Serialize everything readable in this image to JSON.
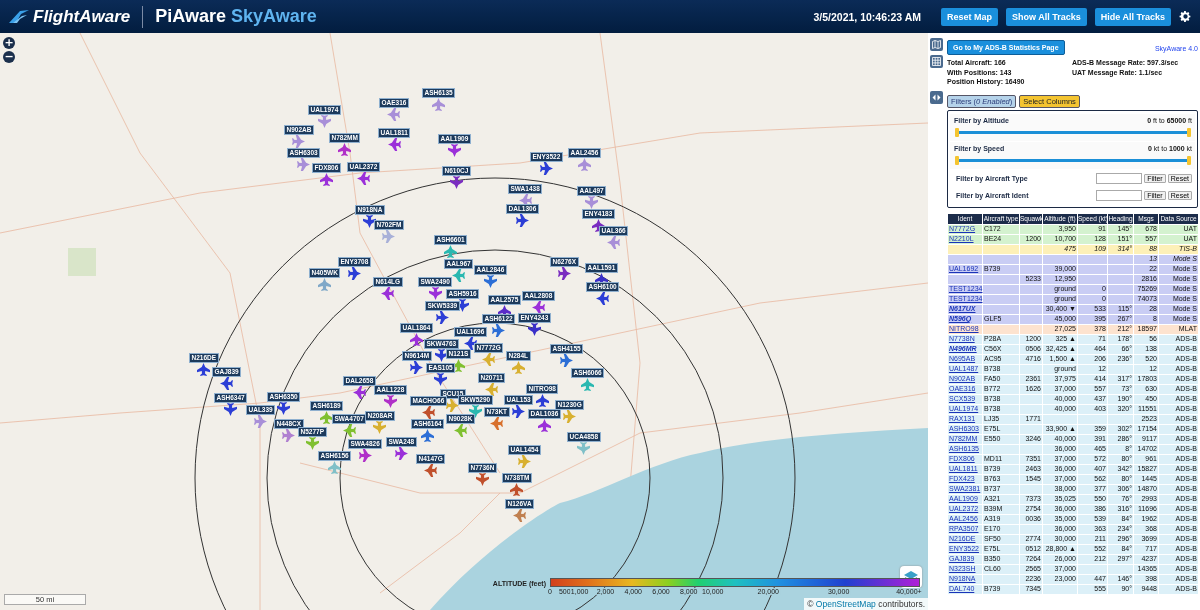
{
  "header": {
    "logo": "FlightAware",
    "title_1": "PiAware",
    "title_2": "SkyAware",
    "datetime": "3/5/2021, 10:46:23 AM",
    "buttons": [
      "Reset Map",
      "Show All Tracks",
      "Hide All Tracks"
    ]
  },
  "map": {
    "zoom_in": "+",
    "zoom_out": "−",
    "aircraft": [
      {
        "label": "ASH6135",
        "color": "#a88fd8"
      },
      {
        "label": "OAE316",
        "color": "#a88fd8"
      },
      {
        "label": "UAL1974",
        "color": "#a88fd8"
      },
      {
        "label": "N902AB",
        "color": "#a88fd8"
      },
      {
        "label": "N782MM",
        "color": "#b030c8"
      },
      {
        "label": "UAL1811",
        "color": "#9b30d9"
      },
      {
        "label": "AAL1909",
        "color": "#9b30d9"
      },
      {
        "label": "ASH6303",
        "color": "#a88fd8"
      },
      {
        "label": "FDX806",
        "color": "#9b30d9"
      },
      {
        "label": "UAL2372",
        "color": "#9b30d9"
      },
      {
        "label": "N610CJ",
        "color": "#7a2cc0"
      },
      {
        "label": "ENY3522",
        "color": "#2c3ed6"
      },
      {
        "label": "AAL2456",
        "color": "#a88fd8"
      },
      {
        "label": "SWA1438",
        "color": "#a88fd8"
      },
      {
        "label": "AAL497",
        "color": "#a88fd8"
      },
      {
        "label": "DAL1306",
        "color": "#2c3ed6"
      },
      {
        "label": "ENY4183",
        "color": "#7a2cc0"
      },
      {
        "label": "UAL366",
        "color": "#a88fd8"
      },
      {
        "label": "N918NA",
        "color": "#2c3ed6"
      },
      {
        "label": "N702FM",
        "color": "#a8b0d8"
      },
      {
        "label": "ASH6601",
        "color": "#2ab8b0"
      },
      {
        "label": "AAL967",
        "color": "#2ab8b0"
      },
      {
        "label": "AAL2846",
        "color": "#2c6ed6"
      },
      {
        "label": "ENY3708",
        "color": "#2c3ed6"
      },
      {
        "label": "N405WK",
        "color": "#80a8c8"
      },
      {
        "label": "N614LG",
        "color": "#9b30d9"
      },
      {
        "label": "SWA2490",
        "color": "#9b30d9"
      },
      {
        "label": "N6276X",
        "color": "#7a2cc0"
      },
      {
        "label": "AAL1591",
        "color": "#3a30c8"
      },
      {
        "label": "ASH6100",
        "color": "#2c3ed6"
      },
      {
        "label": "ASH5916",
        "color": "#2c3ed6"
      },
      {
        "label": "SKW5339",
        "color": "#2c3ed6"
      },
      {
        "label": "AAL2575",
        "color": "#5a2cc8"
      },
      {
        "label": "AAL2808",
        "color": "#9b30d9"
      },
      {
        "label": "ENY4243",
        "color": "#3a30c8"
      },
      {
        "label": "ASH6122",
        "color": "#2c6ed6"
      },
      {
        "label": "UAL1864",
        "color": "#9b30d9"
      },
      {
        "label": "UAL1696",
        "color": "#2c3ed6"
      },
      {
        "label": "SKW4763",
        "color": "#2c3ed6"
      },
      {
        "label": "N9614M",
        "color": "#2c3ed6"
      },
      {
        "label": "N121S",
        "color": "#80c030"
      },
      {
        "label": "N7772G",
        "color": "#d8b030"
      },
      {
        "label": "EAS105",
        "color": "#2c3ed6"
      },
      {
        "label": "ASH4155",
        "color": "#2c6ed6"
      },
      {
        "label": "N216DE",
        "color": "#2c3ed6"
      },
      {
        "label": "GAJ839",
        "color": "#2c3ed6"
      },
      {
        "label": "ASH6347",
        "color": "#2c3ed6"
      },
      {
        "label": "UAL339",
        "color": "#a88fd8"
      },
      {
        "label": "ASH6066",
        "color": "#2ab8b0"
      },
      {
        "label": "DAL2658",
        "color": "#9b30d9"
      },
      {
        "label": "AAL1228",
        "color": "#b030c8"
      },
      {
        "label": "SCU15",
        "color": "#d8b030"
      },
      {
        "label": "N284L",
        "color": "#d8b030"
      },
      {
        "label": "N20711",
        "color": "#d8b030"
      },
      {
        "label": "SKW5290",
        "color": "#2ab8b0"
      },
      {
        "label": "UAL153",
        "color": "#2c3ed6"
      },
      {
        "label": "NITRO98",
        "color": "#2c3ed6"
      },
      {
        "label": "MACHO66",
        "color": "#c0502c"
      },
      {
        "label": "ASH6350",
        "color": "#2c3ed6"
      },
      {
        "label": "N448CX",
        "color": "#b080d0"
      },
      {
        "label": "ASH6189",
        "color": "#80c030"
      },
      {
        "label": "SWA4707",
        "color": "#80c030"
      },
      {
        "label": "N208AR",
        "color": "#d8b030"
      },
      {
        "label": "N1230G",
        "color": "#d8b030"
      },
      {
        "label": "DAL1036",
        "color": "#9b30d9"
      },
      {
        "label": "N73KT",
        "color": "#d8702c"
      },
      {
        "label": "N5277P",
        "color": "#80c030"
      },
      {
        "label": "SWA4826",
        "color": "#b030c8"
      },
      {
        "label": "ASH6164",
        "color": "#2c6ed6"
      },
      {
        "label": "N9028K",
        "color": "#80c030"
      },
      {
        "label": "UCA4858",
        "color": "#80c0c8"
      },
      {
        "label": "SWA248",
        "color": "#9b30d9"
      },
      {
        "label": "ASH6156",
        "color": "#80c0c8"
      },
      {
        "label": "N4147G",
        "color": "#c0502c"
      },
      {
        "label": "N7736N",
        "color": "#c0502c"
      },
      {
        "label": "UAL1454",
        "color": "#d8b030"
      },
      {
        "label": "N738TM",
        "color": "#c0502c"
      },
      {
        "label": "N126VA",
        "color": "#c08050"
      }
    ],
    "legend": {
      "title": "ALTITUDE (feet)",
      "ticks": [
        "0",
        "500",
        "1,000",
        "2,000",
        "4,000",
        "6,000",
        "8,000",
        "10,000",
        "20,000",
        "30,000",
        "40,000+"
      ]
    },
    "scale": "50 mi",
    "attribution_prefix": "©",
    "attribution_link": "OpenStreetMap",
    "attribution_suffix": "contributors."
  },
  "panel": {
    "stats_button": "Go to My ADS-B Statistics Page",
    "version": "SkyAware 4.0",
    "stats_left": [
      "Total Aircraft: 166",
      "With Positions: 143",
      "Position History: 16490"
    ],
    "stats_right": [
      "ADS-B Message Rate: 597.3/sec",
      "UAT Message Rate: 1.1/sec"
    ],
    "tabs": [
      {
        "label": "Filters (*0 Enabled*)",
        "selected": true
      },
      {
        "label": "Select Columns",
        "selected": false
      }
    ],
    "filters": [
      {
        "kind": "range",
        "label": "Filter by Altitude",
        "reading": "**0** ft to **65000** ft",
        "level": 1
      },
      {
        "kind": "range",
        "label": "Filter by Speed",
        "reading": "**0** kt to **1000** kt",
        "level": 1
      },
      {
        "kind": "text",
        "label": "Filter by Aircraft Type",
        "buttons": [
          "Filter",
          "Reset"
        ]
      },
      {
        "kind": "text",
        "label": "Filter by Aircraft Ident",
        "buttons": [
          "Filter",
          "Reset"
        ]
      }
    ]
  },
  "table": {
    "columns": [
      "Ident",
      "Aircraft type",
      "Squawk",
      "Altitude (ft)",
      "Speed (kt)",
      "Heading",
      "Msgs",
      "Data Source"
    ],
    "rows": [
      {
        "kind": "uat",
        "ident": "N7772G",
        "type": "C172",
        "altitude": "3,950",
        "speed": "91",
        "heading": "145°",
        "msgs": "678",
        "source": "UAT"
      },
      {
        "kind": "uat",
        "ident": "N2210L",
        "type": "BE24",
        "squawk": "1200",
        "altitude": "10,700",
        "speed": "128",
        "heading": "151°",
        "msgs": "557",
        "source": "UAT"
      },
      {
        "kind": "tisb",
        "italic": true,
        "altitude": "475",
        "speed": "109",
        "heading": "314°",
        "msgs": "88",
        "source": "TIS-B"
      },
      {
        "kind": "modes",
        "italic": true,
        "msgs": "13",
        "source": "Mode S"
      },
      {
        "kind": "modes",
        "ident": "UAL1692",
        "type": "B739",
        "altitude": "39,000",
        "msgs": "22",
        "source": "Mode S"
      },
      {
        "kind": "modes",
        "squawk": "5233",
        "altitude": "12,950",
        "msgs": "2816",
        "source": "Mode S"
      },
      {
        "kind": "modes",
        "ident": "TEST1234",
        "altitude": "ground",
        "speed": "0",
        "msgs": "75269",
        "source": "Mode S"
      },
      {
        "kind": "modes",
        "ident": "TEST1234",
        "altitude": "ground",
        "speed": "0",
        "msgs": "74073",
        "source": "Mode S"
      },
      {
        "kind": "modes",
        "ident": "N617UX",
        "ident_emphasis": true,
        "altitude": "30,400 ▼",
        "speed": "533",
        "heading": "115°",
        "msgs": "28",
        "source": "Mode S"
      },
      {
        "kind": "modes",
        "ident": "N596Q",
        "ident_emphasis": true,
        "type": "GLF5",
        "altitude": "45,000",
        "speed": "395",
        "heading": "267°",
        "msgs": "8",
        "source": "Mode S"
      },
      {
        "kind": "mlat",
        "ident": "NITRO98",
        "altitude": "27,025",
        "speed": "378",
        "heading": "212°",
        "msgs": "18597",
        "source": "MLAT"
      },
      {
        "kind": "adsb",
        "ident": "N7738N",
        "type": "P28A",
        "squawk": "1200",
        "altitude": "325 ▲",
        "speed": "71",
        "heading": "178°",
        "msgs": "56",
        "source": "ADS-B"
      },
      {
        "kind": "adsb",
        "ident": "N496MR",
        "ident_emphasis": true,
        "type": "C56X",
        "squawk": "0506",
        "altitude": "32,425 ▲",
        "speed": "464",
        "heading": "66°",
        "msgs": "138",
        "source": "ADS-B"
      },
      {
        "kind": "adsb",
        "ident": "N695AB",
        "type": "AC95",
        "squawk": "4716",
        "altitude": "1,500 ▲",
        "speed": "206",
        "heading": "236°",
        "msgs": "520",
        "source": "ADS-B"
      },
      {
        "kind": "adsb",
        "ident": "UAL1487",
        "type": "B738",
        "altitude": "ground",
        "speed": "12",
        "msgs": "12",
        "source": "ADS-B"
      },
      {
        "kind": "adsb",
        "ident": "N902AB",
        "type": "FA50",
        "squawk": "2361",
        "altitude": "37,975",
        "speed": "414",
        "heading": "317°",
        "msgs": "17803",
        "source": "ADS-B"
      },
      {
        "kind": "adsb",
        "ident": "OAE316",
        "type": "B772",
        "squawk": "1626",
        "altitude": "37,000",
        "speed": "557",
        "heading": "73°",
        "msgs": "630",
        "source": "ADS-B"
      },
      {
        "kind": "adsb",
        "ident": "SCX539",
        "type": "B738",
        "altitude": "40,000",
        "speed": "437",
        "heading": "190°",
        "msgs": "450",
        "source": "ADS-B"
      },
      {
        "kind": "adsb",
        "ident": "UAL1974",
        "type": "B738",
        "altitude": "40,000",
        "speed": "403",
        "heading": "320°",
        "msgs": "11551",
        "source": "ADS-B"
      },
      {
        "kind": "adsb",
        "ident": "RAX131",
        "type": "LJ35",
        "squawk": "1771",
        "msgs": "2523",
        "source": "ADS-B"
      },
      {
        "kind": "adsb",
        "ident": "ASH6303",
        "type": "E75L",
        "altitude": "33,900 ▲",
        "speed": "359",
        "heading": "302°",
        "msgs": "17154",
        "source": "ADS-B"
      },
      {
        "kind": "adsb",
        "ident": "N782MM",
        "type": "E550",
        "squawk": "3246",
        "altitude": "40,000",
        "speed": "391",
        "heading": "286°",
        "msgs": "9117",
        "source": "ADS-B"
      },
      {
        "kind": "adsb",
        "ident": "ASH6135",
        "altitude": "36,000",
        "speed": "465",
        "heading": "8°",
        "msgs": "14702",
        "source": "ADS-B"
      },
      {
        "kind": "adsb",
        "ident": "FDX806",
        "type": "MD11",
        "squawk": "7351",
        "altitude": "37,000",
        "speed": "572",
        "heading": "80°",
        "msgs": "961",
        "source": "ADS-B"
      },
      {
        "kind": "adsb",
        "ident": "UAL1811",
        "type": "B739",
        "squawk": "2463",
        "altitude": "36,000",
        "speed": "407",
        "heading": "342°",
        "msgs": "15827",
        "source": "ADS-B"
      },
      {
        "kind": "adsb",
        "ident": "FDX423",
        "type": "B763",
        "squawk": "1545",
        "altitude": "37,000",
        "speed": "562",
        "heading": "80°",
        "msgs": "1445",
        "source": "ADS-B"
      },
      {
        "kind": "adsb",
        "ident": "SWA2381",
        "type": "B737",
        "altitude": "38,000",
        "speed": "377",
        "heading": "306°",
        "msgs": "14870",
        "source": "ADS-B"
      },
      {
        "kind": "adsb",
        "ident": "AAL1909",
        "type": "A321",
        "squawk": "7373",
        "altitude": "35,025",
        "speed": "550",
        "heading": "76°",
        "msgs": "2993",
        "source": "ADS-B"
      },
      {
        "kind": "adsb",
        "ident": "UAL2372",
        "type": "B39M",
        "squawk": "2754",
        "altitude": "36,000",
        "speed": "386",
        "heading": "316°",
        "msgs": "11696",
        "source": "ADS-B"
      },
      {
        "kind": "adsb",
        "ident": "AAL2456",
        "type": "A319",
        "squawk": "0036",
        "altitude": "35,000",
        "speed": "539",
        "heading": "84°",
        "msgs": "1962",
        "source": "ADS-B"
      },
      {
        "kind": "adsb",
        "ident": "RPA3507",
        "type": "E170",
        "altitude": "36,000",
        "speed": "363",
        "heading": "234°",
        "msgs": "368",
        "source": "ADS-B"
      },
      {
        "kind": "adsb",
        "ident": "N216DE",
        "type": "SF50",
        "squawk": "2774",
        "altitude": "30,000",
        "speed": "211",
        "heading": "296°",
        "msgs": "3699",
        "source": "ADS-B"
      },
      {
        "kind": "adsb",
        "ident": "ENY3522",
        "type": "E75L",
        "squawk": "0512",
        "altitude": "28,800 ▲",
        "speed": "552",
        "heading": "84°",
        "msgs": "717",
        "source": "ADS-B"
      },
      {
        "kind": "adsb",
        "ident": "GAJ839",
        "type": "B350",
        "squawk": "7264",
        "altitude": "26,000",
        "speed": "212",
        "heading": "297°",
        "msgs": "4237",
        "source": "ADS-B"
      },
      {
        "kind": "adsb",
        "ident": "N323SH",
        "type": "CL60",
        "squawk": "2565",
        "altitude": "37,000",
        "msgs": "14365",
        "source": "ADS-B"
      },
      {
        "kind": "adsb",
        "ident": "N918NA",
        "squawk": "2236",
        "altitude": "23,000",
        "speed": "447",
        "heading": "146°",
        "msgs": "398",
        "source": "ADS-B"
      },
      {
        "kind": "adsb",
        "ident": "DAL740",
        "type": "B739",
        "squawk": "7345",
        "speed": "555",
        "heading": "90°",
        "msgs": "9448",
        "source": "ADS-B"
      }
    ]
  }
}
